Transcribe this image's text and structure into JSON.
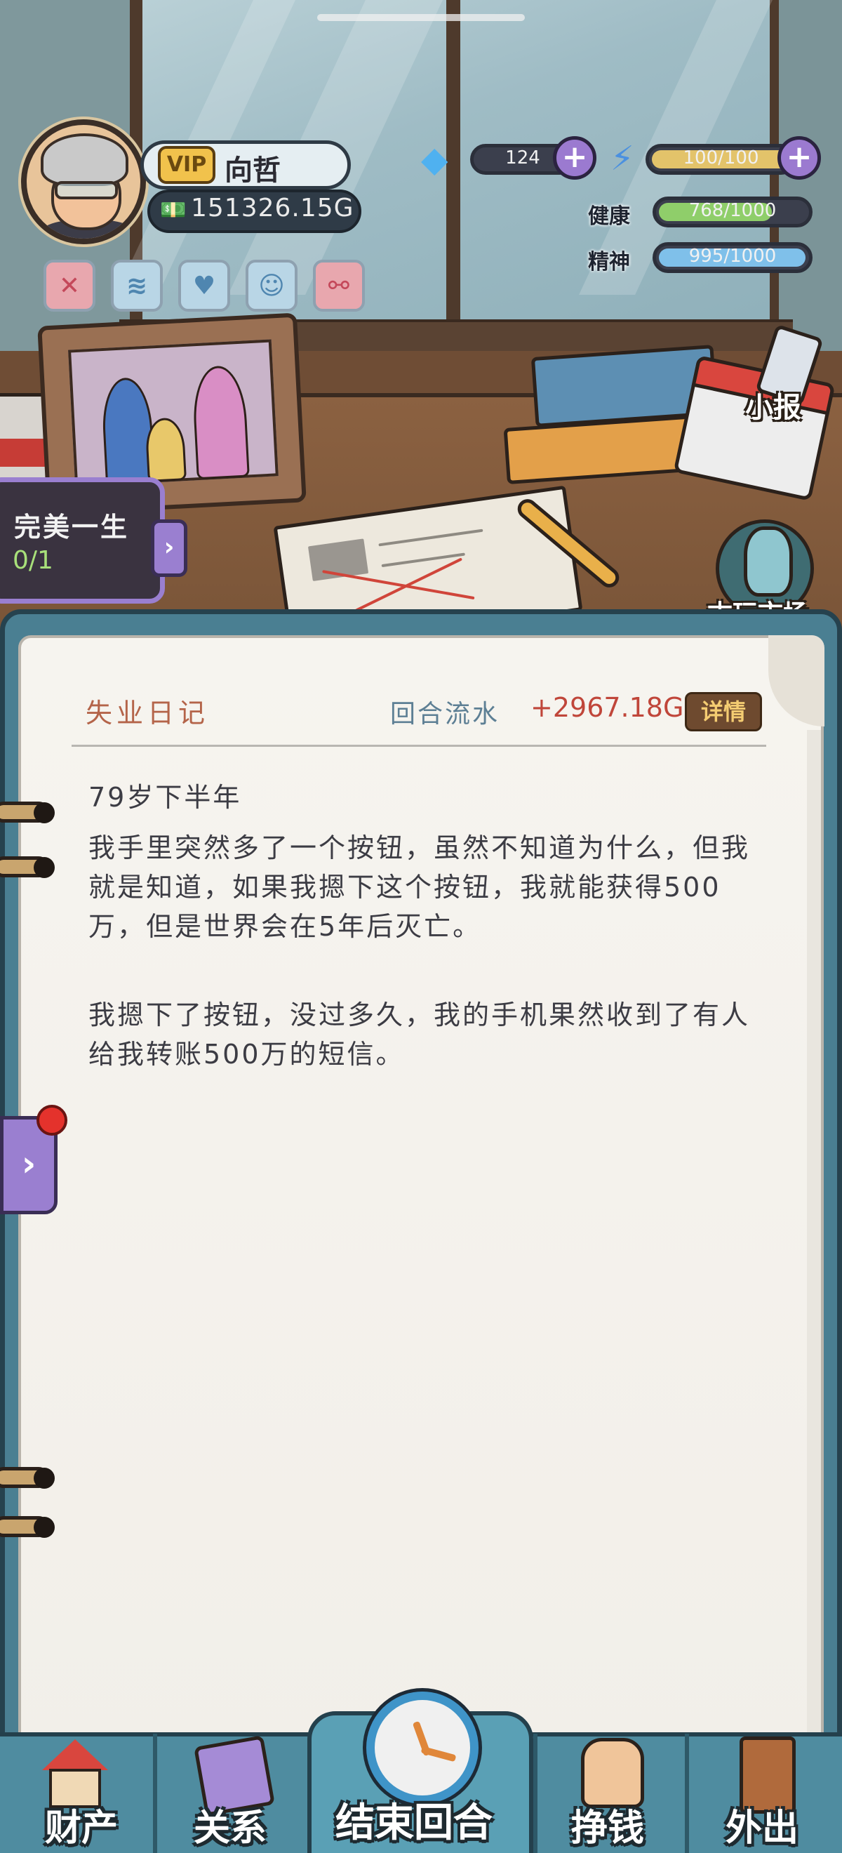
{
  "player": {
    "vip": "VIP",
    "name": "向哲",
    "money": "151326.15G"
  },
  "resources": {
    "diamonds": "124",
    "energy": "100/100",
    "health_label": "健康",
    "health": "768/1000",
    "health_fraction": 0.768,
    "spirit_label": "精神",
    "spirit": "995/1000",
    "spirit_fraction": 0.995,
    "energy_fraction": 1.0
  },
  "quick_icons": [
    {
      "icon": "close-circle-icon",
      "glyph": "✕",
      "color": "#e8a7ae"
    },
    {
      "icon": "sound-wave-icon",
      "glyph": "≋",
      "color": "#b9d6e6"
    },
    {
      "icon": "heart-icon",
      "glyph": "♥",
      "color": "#b9d6e6"
    },
    {
      "icon": "person-icon",
      "glyph": "☺",
      "color": "#b9d6e6"
    },
    {
      "icon": "share-node-icon",
      "glyph": "⚯",
      "color": "#e8a7ae"
    }
  ],
  "scene": {
    "newspaper_label": "小报",
    "antique_label": "古玩市场"
  },
  "achievement": {
    "title": "完美一生",
    "progress": "0/1",
    "arrow": "›"
  },
  "diary": {
    "title": "失业日记",
    "turn_label": "回合流水",
    "turn_value": "+2967.18G",
    "detail_label": "详情",
    "period": "79岁下半年",
    "paragraph1": "我手里突然多了一个按钮，虽然不知道为什么，但我就是知道，如果我摁下这个按钮，我就能获得500万，但是世界会在5年后灭亡。",
    "paragraph2": "我摁下了按钮，没过多久，我的手机果然收到了有人给我转账500万的短信。"
  },
  "side_tab_arrow": "›",
  "nav": {
    "assets": "财产",
    "relations": "关系",
    "end_turn": "结束回合",
    "earn": "挣钱",
    "go_out": "外出"
  },
  "colors": {
    "accent_purple": "#9a7fd0",
    "health_green": "#8fce6a",
    "spirit_blue": "#7fc0ea",
    "energy_gold": "#e3c36a",
    "money_red": "#c0463a"
  }
}
